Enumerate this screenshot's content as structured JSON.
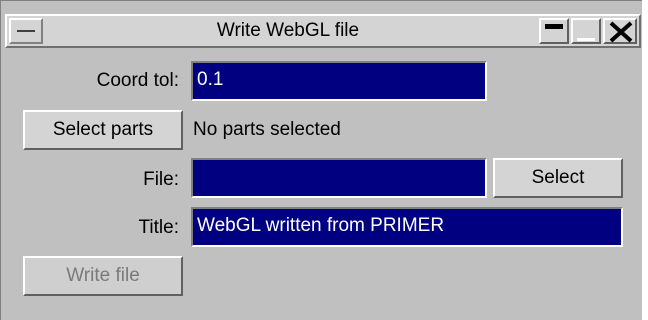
{
  "window": {
    "title": "Write WebGL file"
  },
  "coord_tol": {
    "label": "Coord tol:",
    "value": "0.1"
  },
  "parts": {
    "button_label": "Select parts",
    "status": "No parts selected"
  },
  "file": {
    "label": "File:",
    "value": "",
    "select_label": "Select"
  },
  "title_field": {
    "label": "Title:",
    "value": "WebGL written from PRIMER"
  },
  "actions": {
    "write_label": "Write file"
  },
  "colors": {
    "field_bg": "#000080",
    "panel_bg": "#c0c0c0",
    "field_text": "#ffffff"
  }
}
